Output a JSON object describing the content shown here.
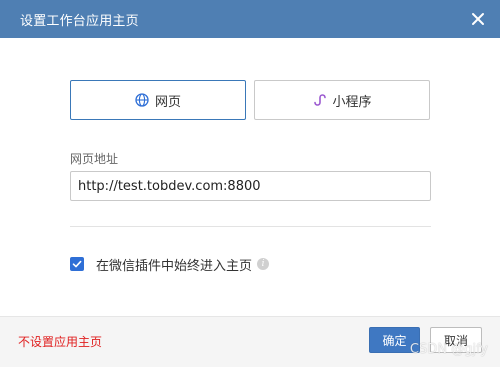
{
  "dialog": {
    "title": "设置工作台应用主页",
    "close_icon": "close-icon",
    "colors": {
      "titlebar_bg": "#4f7fb3",
      "primary": "#3f78c2",
      "danger": "#e02020",
      "checkbox": "#2f6fd6"
    }
  },
  "mode": {
    "web_label": "网页",
    "mini_label": "小程序",
    "selected": "web"
  },
  "url_field": {
    "label": "网页地址",
    "value": "http://test.tobdev.com:8800"
  },
  "option": {
    "label": "在微信插件中始终进入主页",
    "checked": true,
    "info_icon": "info-icon"
  },
  "footer": {
    "no_home_link": "不设置应用主页",
    "ok_label": "确定",
    "cancel_label": "取消",
    "watermark": "CSDN @gjfy"
  }
}
